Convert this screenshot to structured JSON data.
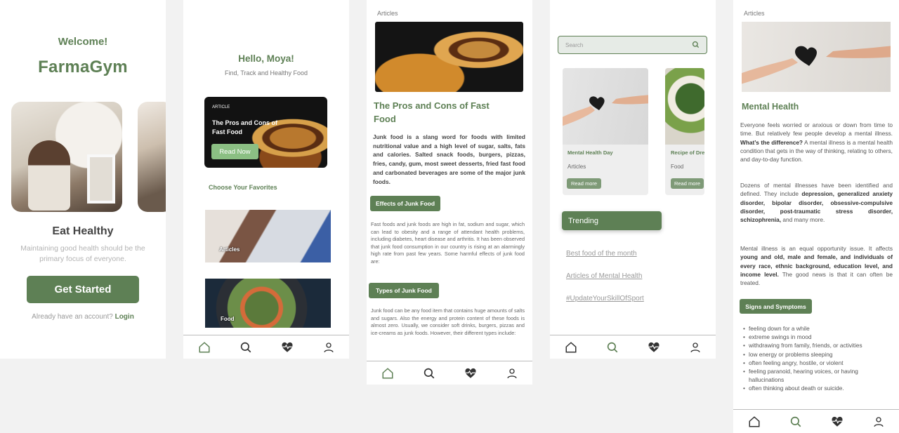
{
  "colors": {
    "brand": "#5e8055",
    "accent_light": "#8bbf83"
  },
  "screen1": {
    "welcome": "Welcome!",
    "brand": "FarmaGym",
    "heading": "Eat Healthy",
    "subtitle": "Maintaining good health should be the primary focus of everyone.",
    "cta": "Get Started",
    "account_prompt": "Already have an account?",
    "login": "Login"
  },
  "screen2": {
    "greeting": "Hello, Moya!",
    "tagline": "Find, Track and Healthy Food",
    "card_tag": "ARTICLE",
    "card_title": "The Pros and Cons of Fast Food",
    "card_button": "Read Now",
    "section": "Choose Your Favorites",
    "fav1": "Articles",
    "fav2": "Food"
  },
  "screen3": {
    "tag": "Articles",
    "title": "The Pros and Cons of Fast Food",
    "intro": "Junk food is a slang word for foods with limited nutritional value and a high level of sugar, salts, fats and calories. Salted snack foods, burgers, pizzas, fries, candy, gum, most sweet desserts, fried fast food and carbonated beverages are some of the major junk foods.",
    "pill1": "Effects of Junk Food",
    "para1": "Fast foods and junk foods are high in fat, sodium and sugar, which can lead to obesity and a range of attendant health problems, including diabetes, heart disease and arthritis. It has been observed that junk food consumption in our country is rising at an alarmingly high rate from past few years. Some harmful effects of junk food are:",
    "pill2": "Types of Junk Food",
    "para2": "Junk food can be any food item that contains huge amounts of salts and sugars. Also the energy and protein content of these foods is almost zero. Usually, we consider soft drinks, burgers, pizzas and ice-creams as junk foods. However, their different types include:"
  },
  "screen4": {
    "search_placeholder": "Search",
    "card1_title": "Mental Health Day",
    "card1_sub": "Articles",
    "card1_btn": "Read more",
    "card2_title": "Recipe of Dre",
    "card2_sub": "Food",
    "card2_btn": "Read more",
    "trending": "Trending",
    "link1": "Best food of the month",
    "link2": "Articles of Mental Health",
    "link3": "#UpdateYourSkillOfSport"
  },
  "screen5": {
    "tag": "Articles",
    "title": "Mental Health",
    "p1_a": "Everyone feels worried or anxious or down from time to time. But relatively few people develop a mental illness. ",
    "p1_b": "What’s the difference?",
    "p1_c": " A mental illness is a mental health condition that gets in the way of thinking, relating to others, and day-to-day function.",
    "p2_a": "Dozens of mental illnesses have been identified and defined. They include ",
    "p2_b": "depression, generalized anxiety disorder, bipolar disorder, obsessive-compulsive disorder, post-traumatic stress disorder, schizophrenia,",
    "p2_c": " and many more.",
    "p3_a": "Mental illness is an equal opportunity issue. It affects ",
    "p3_b": "young and old, male and female, and individuals of every race, ethnic background, education level, and income level.",
    "p3_c": " The good news is that it can often be treated.",
    "pill": "Signs and Symptoms",
    "symptoms": [
      "feeling down for a while",
      "extreme swings in mood",
      "withdrawing from family, friends, or activities",
      "low energy or problems sleeping",
      "often feeling angry, hostile, or violent",
      "feeling paranoid, hearing voices, or having hallucinations",
      "often thinking about death or suicide."
    ]
  },
  "nav_icons": [
    "home-icon",
    "search-icon",
    "heart-pulse-icon",
    "profile-icon"
  ]
}
